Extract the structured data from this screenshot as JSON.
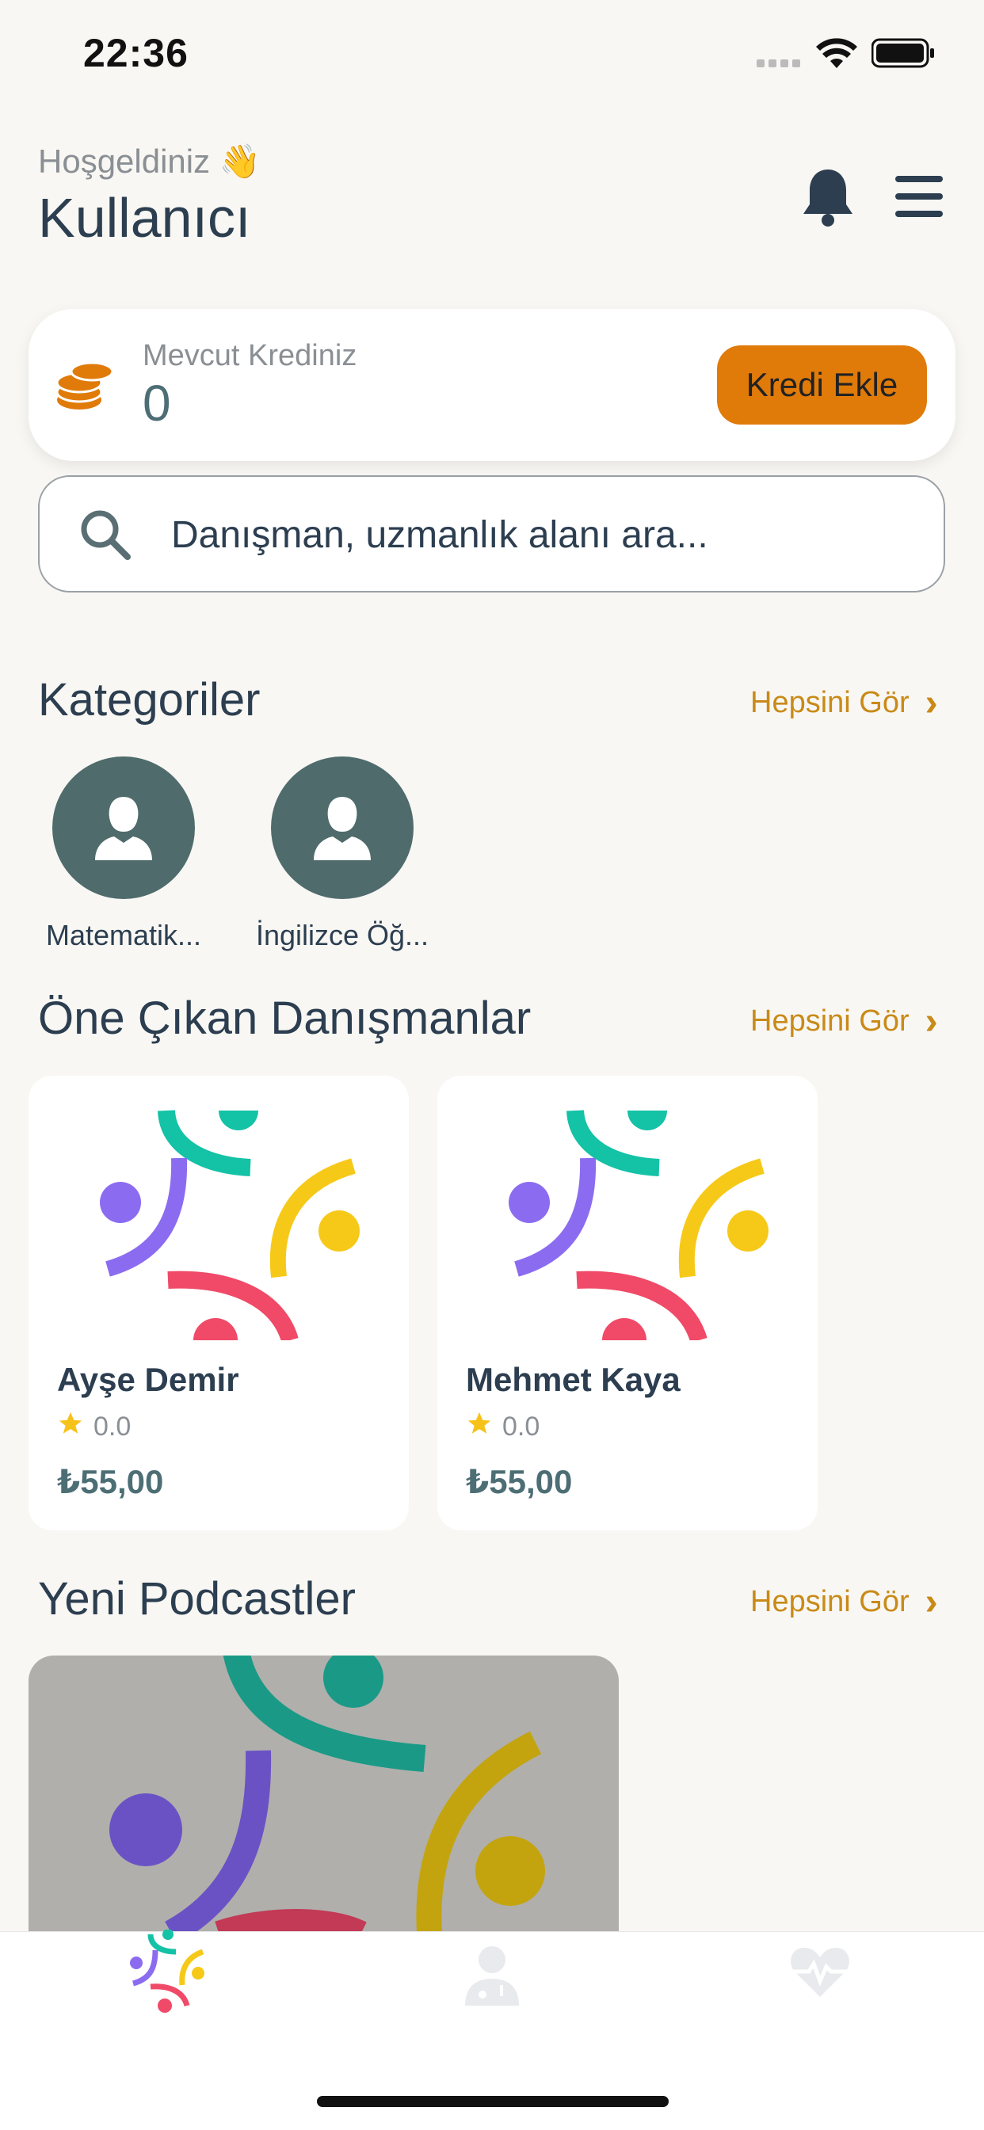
{
  "status_bar": {
    "time": "22:36"
  },
  "header": {
    "greeting": "Hoşgeldiniz 👋",
    "username": "Kullanıcı"
  },
  "credit": {
    "label": "Mevcut Krediniz",
    "value": "0",
    "button_label": "Kredi Ekle"
  },
  "search": {
    "placeholder": "Danışman, uzmanlık alanı ara..."
  },
  "categories": {
    "title": "Kategoriler",
    "see_all": "Hepsini Gör",
    "items": [
      {
        "label": "Matematik..."
      },
      {
        "label": "İngilizce Öğ..."
      }
    ]
  },
  "featured": {
    "title": "Öne Çıkan Danışmanlar",
    "see_all": "Hepsini Gör",
    "items": [
      {
        "name": "Ayşe Demir",
        "rating": "0.0",
        "price": "₺55,00"
      },
      {
        "name": "Mehmet Kaya",
        "rating": "0.0",
        "price": "₺55,00"
      }
    ]
  },
  "podcasts": {
    "title": "Yeni Podcastler",
    "see_all": "Hepsini Gör"
  },
  "colors": {
    "accent": "#e07b0a",
    "link": "#c98a18",
    "text": "#2c3e50",
    "avatar_bg": "#4f6b6c",
    "background": "#f8f7f3"
  },
  "tabs": [
    {
      "icon": "app-logo-icon"
    },
    {
      "icon": "doctor-icon"
    },
    {
      "icon": "heart-pulse-icon"
    }
  ]
}
